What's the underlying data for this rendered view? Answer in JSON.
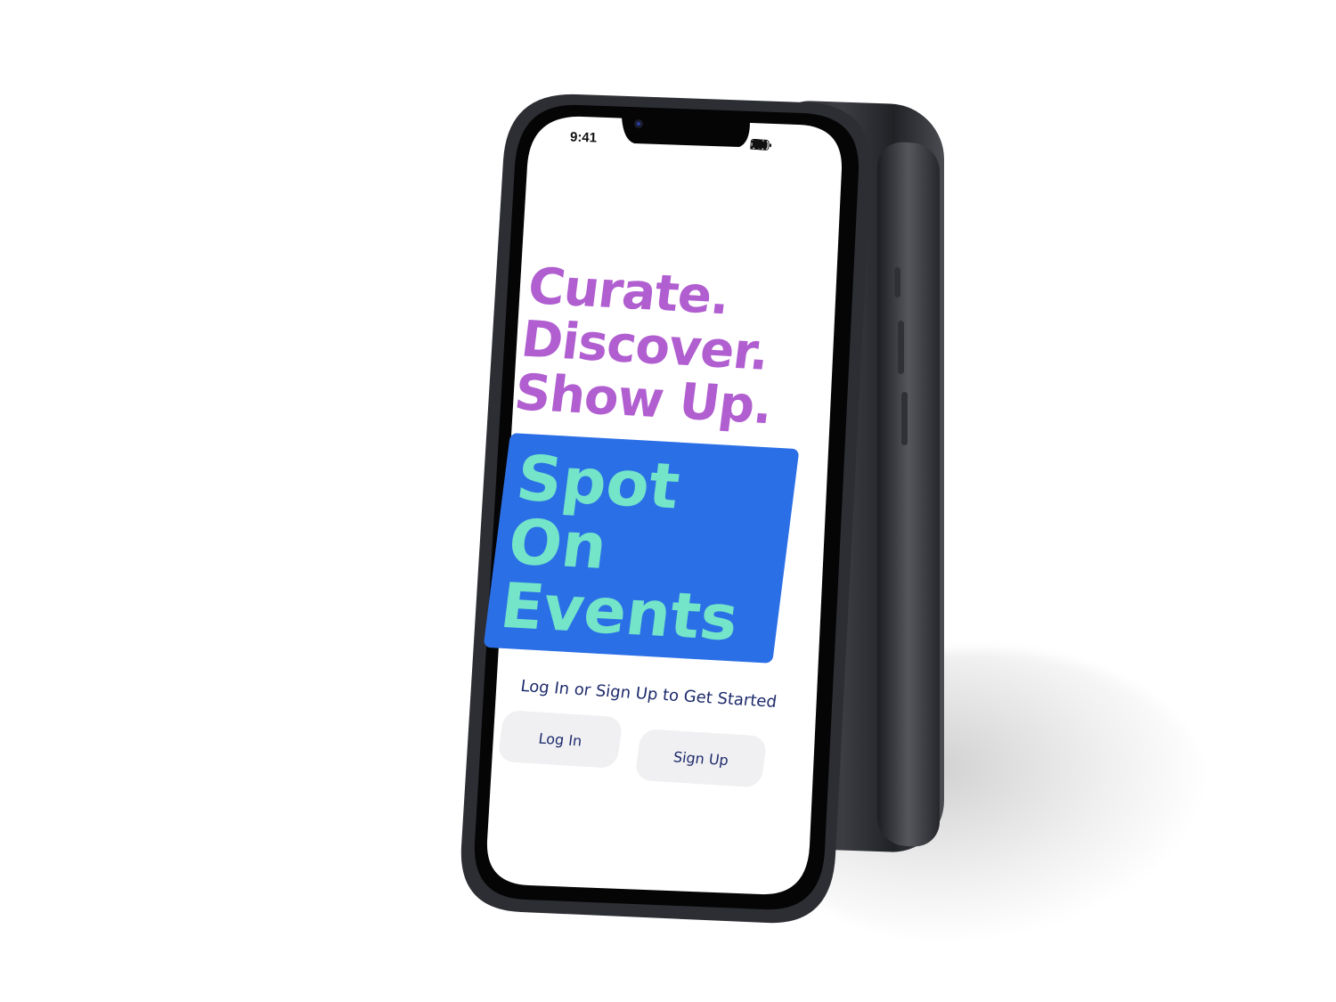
{
  "status_bar": {
    "time": "9:41",
    "signal_icon": "signal-icon",
    "wifi_icon": "wifi-icon",
    "battery_icon": "battery-icon"
  },
  "hero": {
    "tagline_lines": [
      "Curate.",
      "Discover.",
      "Show Up."
    ],
    "brand_lines": [
      "Spot",
      "On",
      "Events"
    ]
  },
  "auth": {
    "prompt": "Log In or Sign Up to Get Started",
    "login_label": "Log In",
    "signup_label": "Sign Up"
  },
  "colors": {
    "tagline": "#b05ed0",
    "brand_background": "#2b6fe6",
    "brand_text": "#74e5c8",
    "body_text": "#1d2a6b",
    "button_background": "#f0f0f2",
    "phone_frame": "#2c2e33"
  }
}
